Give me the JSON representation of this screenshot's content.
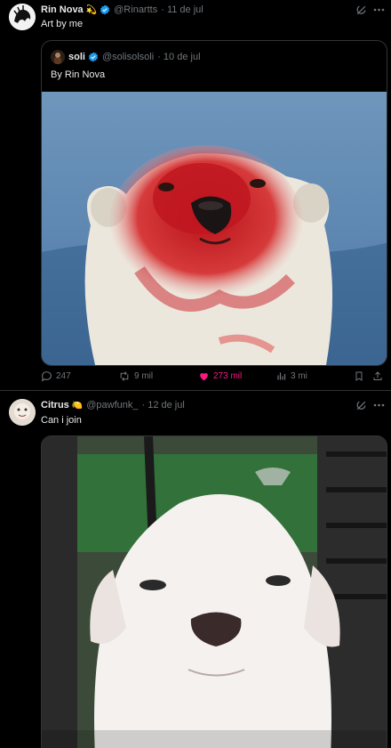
{
  "posts": [
    {
      "author": "Rin Nova",
      "author_emoji": "💫",
      "handle": "@Rinartts",
      "date": "· 11 de jul",
      "text": "Art by me",
      "quote": {
        "author": "soli",
        "handle": "@solisolsoli",
        "date": "· 10 de jul",
        "text": "By Rin Nova"
      },
      "stats": {
        "replies": "247",
        "reposts": "9 mil",
        "likes": "273 mil",
        "views": "3 mi"
      },
      "colors": {
        "like": "#f91880",
        "verified": "#1d9bf0"
      }
    },
    {
      "author": "Citrus",
      "author_emoji": "🍋",
      "handle": "@pawfunk_",
      "date": "· 12 de jul",
      "text": "Can i join"
    }
  ],
  "icons": [
    "grok-icon",
    "more-icon",
    "reply-icon",
    "repost-icon",
    "like-icon",
    "views-icon",
    "bookmark-icon",
    "share-icon",
    "verified-icon"
  ]
}
